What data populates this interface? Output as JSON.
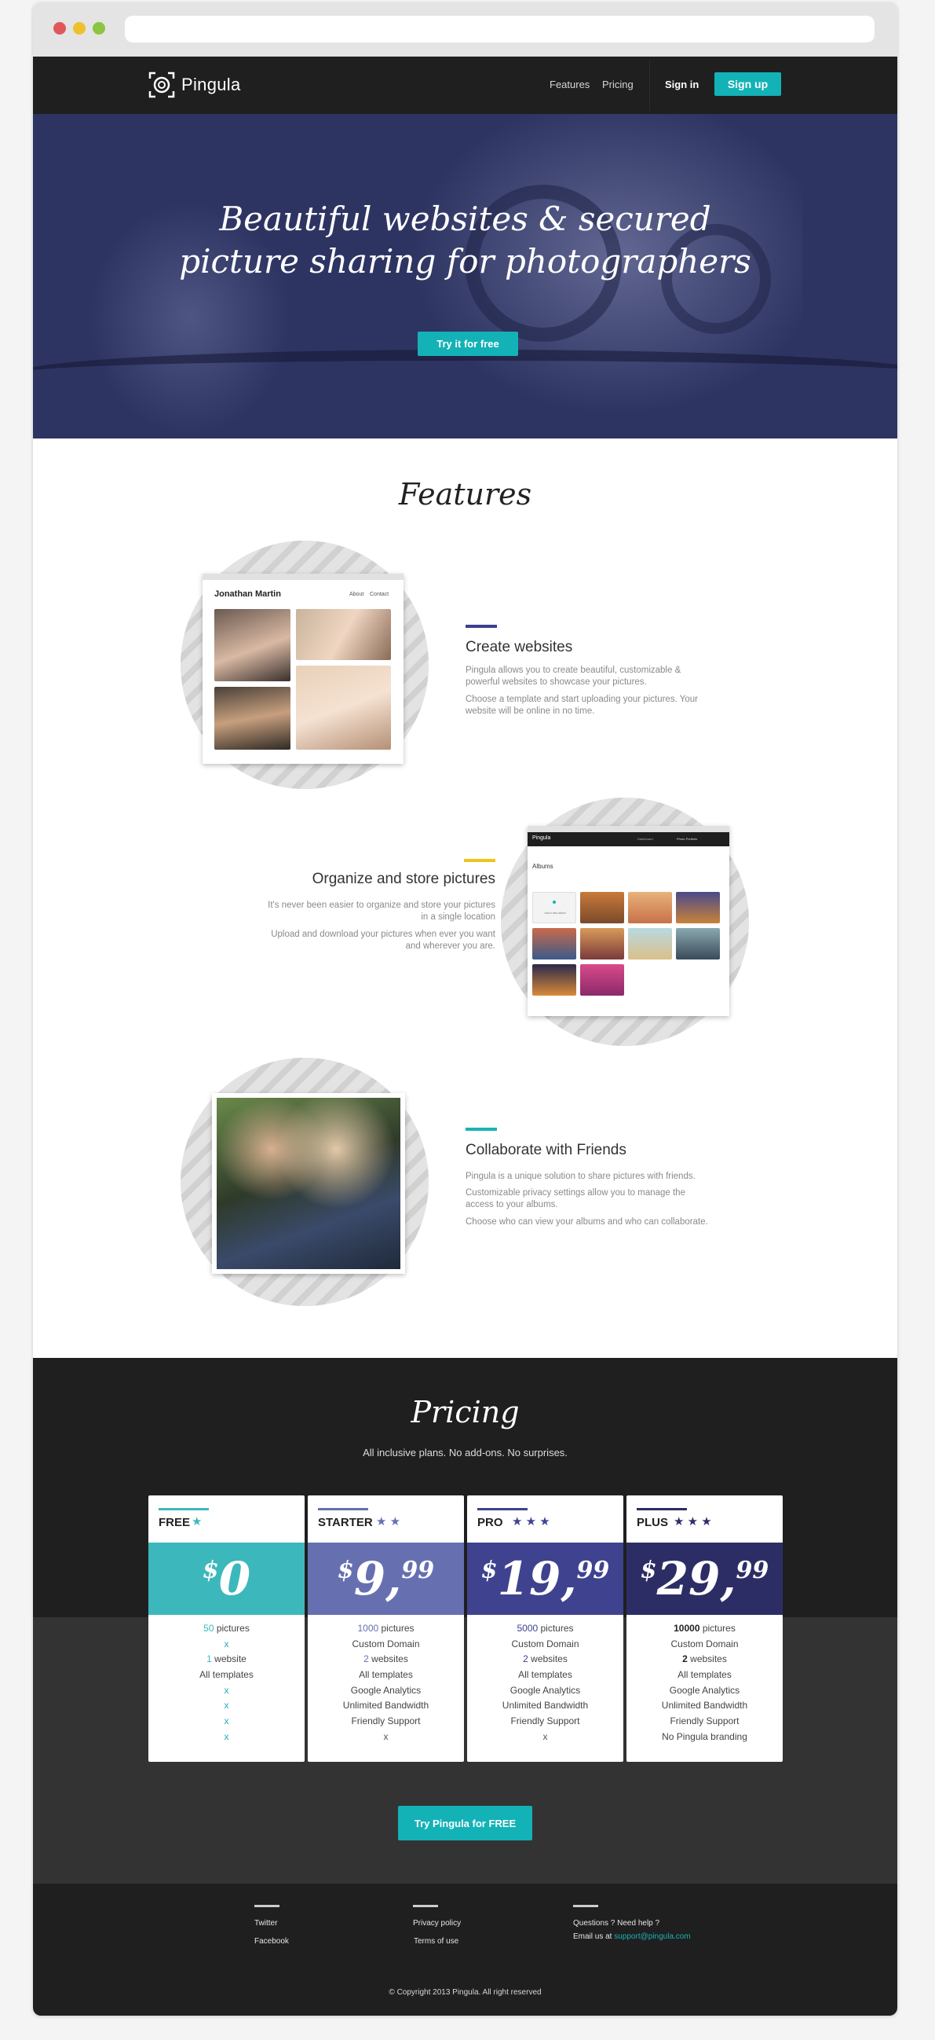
{
  "nav": {
    "logo_text": "Pingula",
    "features_label": "Features",
    "pricing_label": "Pricing",
    "signin_label": "Sign in",
    "signup_label": "Sign up"
  },
  "hero": {
    "title_line1": "Beautiful websites & secured",
    "title_line2": "picture sharing for photographers",
    "cta_label": "Try it for free"
  },
  "features": {
    "title": "Features",
    "items": [
      {
        "title": "Create websites",
        "accent": "#3d3f8f",
        "text1": "Pingula allows you to create beautiful, customizable & powerful websites to showcase your pictures.",
        "text2": "Choose a template and start uploading your pictures. Your website will be online in no time."
      },
      {
        "title": "Organize and store pictures",
        "accent": "#f2c418",
        "text1": "It's never been easier to organize and store your pictures in a single location",
        "text2": "Upload and download your pictures when ever you want and wherever you are."
      },
      {
        "title": "Collaborate with Friends",
        "accent": "#19b3b5",
        "text1": "Pingula is a unique solution to share pictures with friends.",
        "text2": "Customizable privacy settings allow you to manage the access to your albums.",
        "text3": "Choose who can view your albums and who can collaborate."
      }
    ],
    "mock_site": {
      "name": "Jonathan Martin",
      "about": "About",
      "contact": "Contact"
    },
    "mock_albums": {
      "logo": "Pingula",
      "title": "Albums",
      "nav1": "Dashboard",
      "nav2": "Photo Portfolio",
      "add_label": "Add a new album"
    }
  },
  "pricing": {
    "title": "Pricing",
    "subtitle": "All inclusive plans. No add-ons. No surprises.",
    "cta_label": "Try Pingula for FREE",
    "plans": [
      {
        "name": "FREE",
        "stars": "★",
        "color": "#3cb8bc",
        "currency": "$",
        "amount": "0",
        "decimals": "",
        "features": [
          "50 pictures",
          "x",
          "1 website",
          "All templates",
          "x",
          "x",
          "x",
          "x"
        ]
      },
      {
        "name": "STARTER",
        "stars": "★ ★",
        "color": "#6670b1",
        "currency": "$",
        "amount": "9,",
        "decimals": "99",
        "features": [
          "1000 pictures",
          "Custom Domain",
          "2 websites",
          "All templates",
          "Google Analytics",
          "Unlimited Bandwidth",
          "Friendly Support",
          "x"
        ]
      },
      {
        "name": "PRO",
        "stars": "★ ★ ★",
        "color": "#3e428f",
        "currency": "$",
        "amount": "19,",
        "decimals": "99",
        "features": [
          "5000 pictures",
          "Custom Domain",
          "2 websites",
          "All templates",
          "Google Analytics",
          "Unlimited Bandwidth",
          "Friendly Support",
          "x"
        ]
      },
      {
        "name": "PLUS",
        "stars": "★ ★ ★",
        "color": "#2d2d66",
        "currency": "$",
        "amount": "29,",
        "decimals": "99",
        "features": [
          "10000 pictures",
          "Custom Domain",
          "2 websites",
          "All templates",
          "Google Analytics",
          "Unlimited Bandwidth",
          "Friendly Support",
          "No Pingula branding"
        ]
      }
    ]
  },
  "footer": {
    "twitter": "Twitter",
    "facebook": "Facebook",
    "privacy": "Privacy policy",
    "terms": "Terms of use",
    "help": "Questions ? Need help ?",
    "email_prefix": "Email us at",
    "email": "support@pingula.com",
    "copyright": "© Copyright 2013 Pingula. All right reserved"
  },
  "colors": {
    "accent": "#13b2b6",
    "dark": "#1f1f1f",
    "hero": "#2e3462"
  }
}
